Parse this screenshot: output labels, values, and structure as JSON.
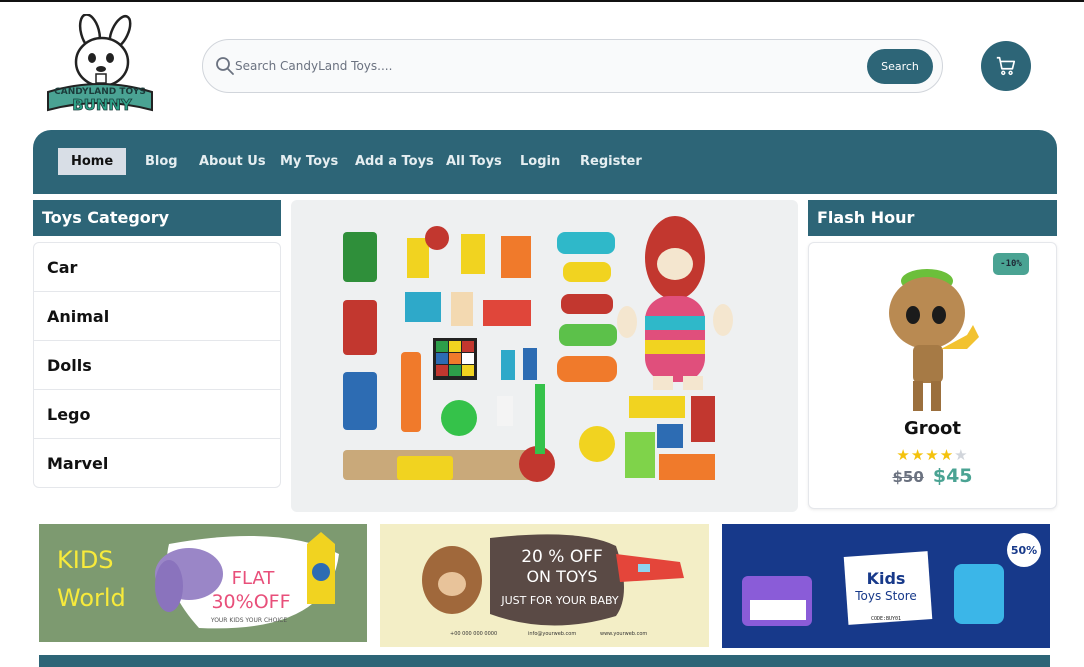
{
  "brand": {
    "logo_line1": "CANDYLAND TOYS",
    "logo_line2": "BUNNY"
  },
  "search": {
    "placeholder": "Search CandyLand Toys....",
    "button_label": "Search"
  },
  "nav": {
    "items": [
      {
        "label": "Home",
        "active": true
      },
      {
        "label": "Blog"
      },
      {
        "label": "About Us"
      },
      {
        "label": "My Toys"
      },
      {
        "label": "Add a Toys"
      },
      {
        "label": "All Toys"
      },
      {
        "label": "Login"
      },
      {
        "label": "Register"
      }
    ]
  },
  "category": {
    "title": "Toys Category",
    "items": [
      "Car",
      "Animal",
      "Dolls",
      "Lego",
      "Marvel"
    ]
  },
  "flash": {
    "title": "Flash Hour",
    "discount_badge": "-10%",
    "product_name": "Groot",
    "rating": 4,
    "rating_max": 5,
    "old_price": "$50",
    "new_price": "$45"
  },
  "banners": {
    "b1": {
      "line1": "KIDS",
      "line2": "World",
      "offer1": "FLAT",
      "offer2": "30%OFF",
      "tagline": "YOUR KIDS YOUR CHOICE"
    },
    "b2": {
      "line1": "20 % OFF",
      "line2": "ON TOYS",
      "line3": "JUST FOR YOUR BABY",
      "contact1": "+00 000 000 0000",
      "contact2": "info@yourweb.com",
      "contact3": "www.yourweb.com"
    },
    "b3": {
      "title1": "Kids",
      "title2": "Toys Store",
      "code": "CODE:BUY01",
      "badge": "50%"
    }
  },
  "colors": {
    "primary": "#2d6577",
    "accent": "#4aa393",
    "star": "#f4c20d"
  },
  "icons": {
    "search": "search-icon",
    "cart": "cart-icon"
  }
}
